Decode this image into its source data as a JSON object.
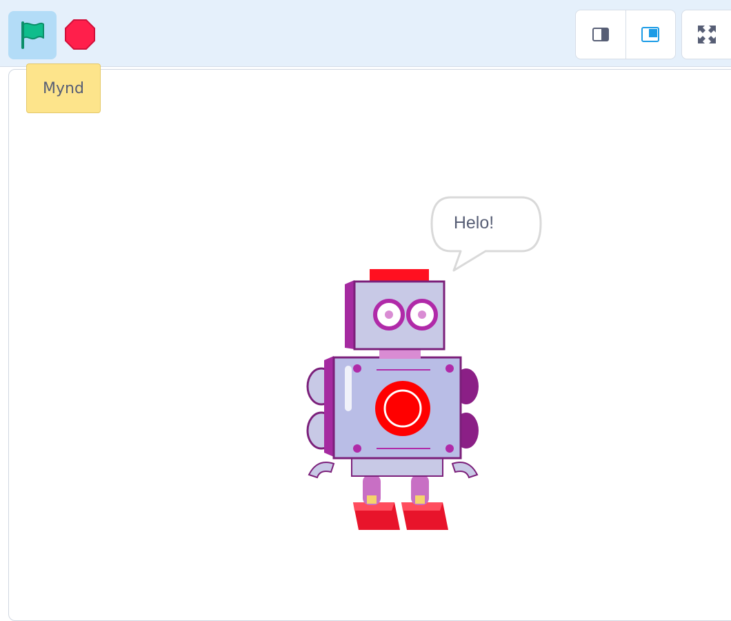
{
  "toolbar": {
    "green_flag_icon": "green-flag-icon",
    "stop_icon": "stop-sign-icon",
    "layout_small_icon": "small-stage-layout-icon",
    "layout_normal_icon": "normal-stage-layout-icon",
    "fullscreen_icon": "fullscreen-icon",
    "colors": {
      "flag": "#0fbd8c",
      "stop": "#ff1f4b",
      "active_layout": "#1a9be6"
    }
  },
  "tooltip": {
    "text": "Mynd"
  },
  "stage": {
    "sprite": {
      "name_icon": "robot-sprite",
      "speech": "Helo!"
    }
  }
}
